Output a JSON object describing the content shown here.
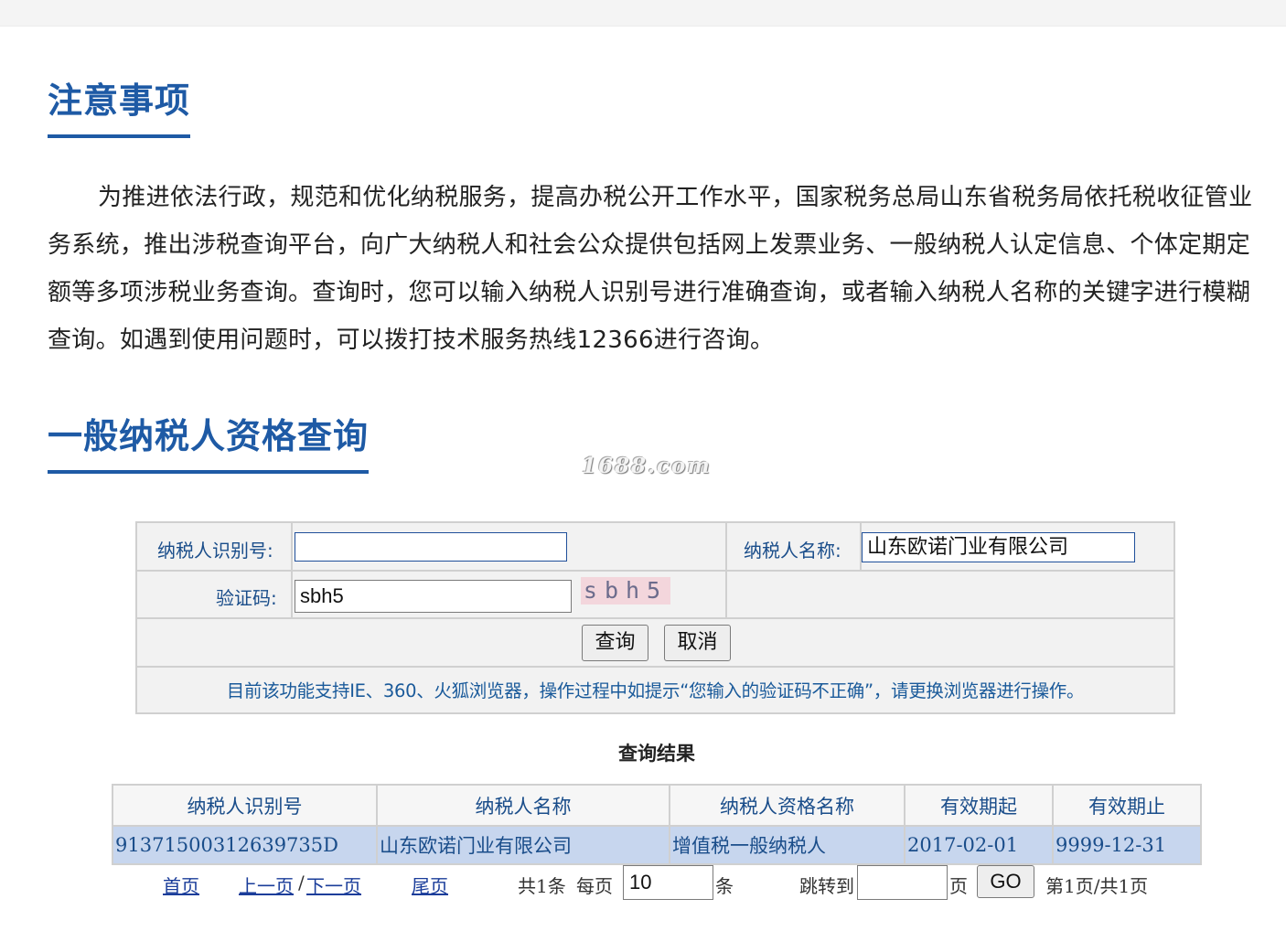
{
  "notice": {
    "title": "注意事项",
    "body": "为推进依法行政，规范和优化纳税服务，提高办税公开工作水平，国家税务总局山东省税务局依托税收征管业务系统，推出涉税查询平台，向广大纳税人和社会公众提供包括网上发票业务、一般纳税人认定信息、个体定期定额等多项涉税业务查询。查询时，您可以输入纳税人识别号进行准确查询，或者输入纳税人名称的关键字进行模糊查询。如遇到使用问题时，可以拨打技术服务热线12366进行咨询。"
  },
  "query": {
    "title": "一般纳税人资格查询",
    "watermark": "1688.com",
    "taxpayer_id_label": "纳税人识别号:",
    "taxpayer_id_value": "",
    "taxpayer_name_label": "纳税人名称:",
    "taxpayer_name_value": "山东欧诺门业有限公司",
    "captcha_label": "验证码:",
    "captcha_value": "sbh5",
    "captcha_image_text": "sbh5",
    "submit_label": "查询",
    "cancel_label": "取消",
    "tip": "目前该功能支持IE、360、火狐浏览器，操作过程中如提示“您输入的验证码不正确”，请更换浏览器进行操作。"
  },
  "results": {
    "title": "查询结果",
    "columns": [
      "纳税人识别号",
      "纳税人名称",
      "纳税人资格名称",
      "有效期起",
      "有效期止"
    ],
    "rows": [
      [
        "91371500312639735D",
        "山东欧诺门业有限公司",
        "增值税一般纳税人",
        "2017-02-01",
        "9999-12-31"
      ]
    ]
  },
  "pager": {
    "first": "首页",
    "prev": "上一页",
    "sep": "/",
    "next": "下一页",
    "last": "尾页",
    "total": "共1条",
    "per_page_label": "每页",
    "per_page_value": "10",
    "per_page_unit": "条",
    "jump_label": "跳转到",
    "jump_value": "",
    "jump_unit": "页",
    "go_label": "GO",
    "page_info": "第1页/共1页"
  },
  "colors": {
    "accent": "#1e5aa5",
    "label_text": "#1a4d8a",
    "row_highlight": "#c7d6ee",
    "form_bg": "#f2f2f2"
  }
}
